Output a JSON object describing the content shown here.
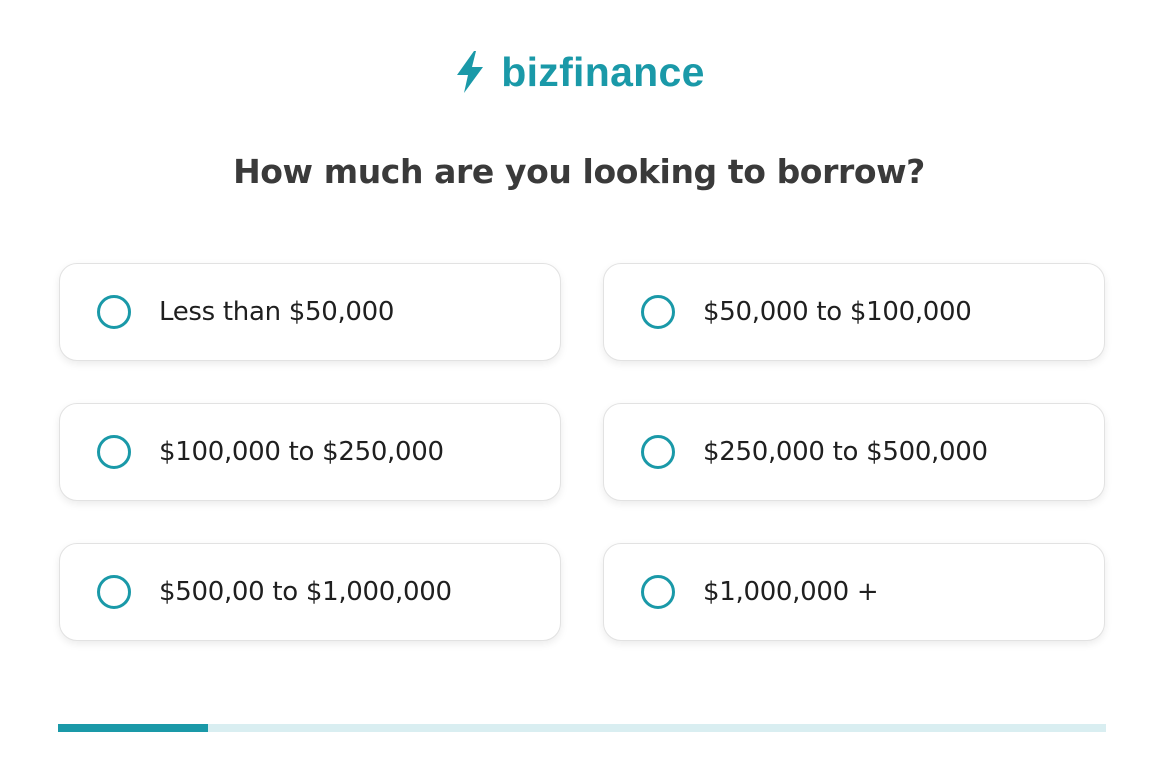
{
  "brand": {
    "name": "bizfinance",
    "color": "#1a99a8",
    "icon": "lightning-bolt-icon"
  },
  "question": "How much are you looking to borrow?",
  "options": [
    {
      "label": "Less than $50,000"
    },
    {
      "label": "$50,000 to $100,000"
    },
    {
      "label": "$100,000 to $250,000"
    },
    {
      "label": "$250,000 to $500,000"
    },
    {
      "label": "$500,00 to $1,000,000"
    },
    {
      "label": "$1,000,000 +"
    }
  ],
  "progress": {
    "fraction": 0.143,
    "fill_color": "#1a99a8",
    "track_color": "#d9eef1"
  }
}
